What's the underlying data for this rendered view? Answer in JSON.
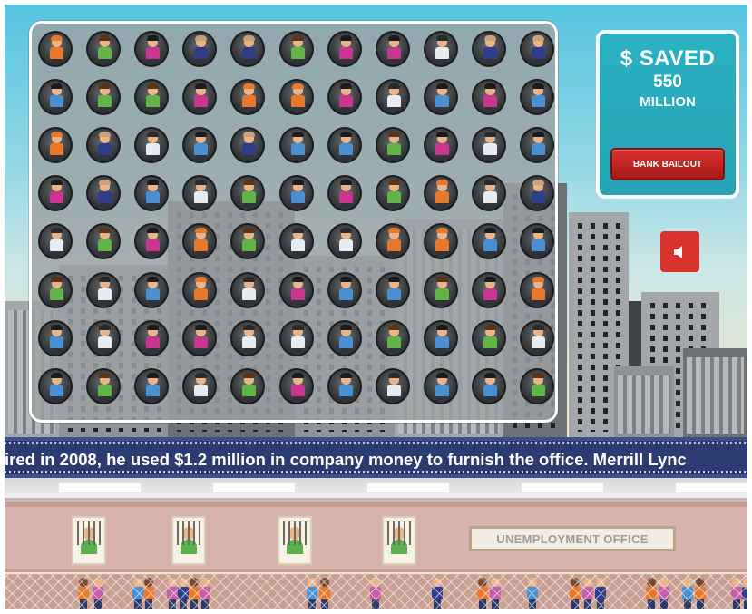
{
  "score": {
    "label": "$ SAVED",
    "amount": "550",
    "unit": "MILLION"
  },
  "buttons": {
    "bailout_label": "BANK BAILOUT",
    "mute_icon": "speaker-icon"
  },
  "ticker": {
    "text": "ired in 2008, he used $1.2 million in company money to furnish the office. Merrill Lync"
  },
  "office": {
    "sign": "UNEMPLOYMENT OFFICE"
  },
  "colors": {
    "sky": "#56c4df",
    "panel": "#2bb1c2",
    "button_red": "#d8322d",
    "ticker_bg": "#2d3b73",
    "office_wall": "#d8b2ad"
  },
  "board": {
    "rows": 8,
    "cols": 11,
    "grid": [
      [
        "orange",
        "green",
        "pink",
        "navy",
        "navy",
        "green",
        "pink",
        "pink",
        "white",
        "navy",
        "navy"
      ],
      [
        "blue",
        "green",
        "green",
        "pink",
        "orange",
        "orange",
        "pink",
        "white",
        "blue",
        "pink",
        "blue"
      ],
      [
        "orange",
        "navy",
        "white",
        "blue",
        "navy",
        "blue",
        "blue",
        "green",
        "pink",
        "white",
        "blue"
      ],
      [
        "pink",
        "navy",
        "blue",
        "white",
        "green",
        "blue",
        "pink",
        "green",
        "orange",
        "white",
        "navy"
      ],
      [
        "white",
        "green",
        "pink",
        "orange",
        "green",
        "white",
        "white",
        "orange",
        "orange",
        "blue",
        "blue"
      ],
      [
        "green",
        "white",
        "blue",
        "orange",
        "white",
        "pink",
        "blue",
        "blue",
        "green",
        "pink",
        "orange"
      ],
      [
        "blue",
        "white",
        "pink",
        "pink",
        "white",
        "white",
        "blue",
        "green",
        "blue",
        "green",
        "white"
      ],
      [
        "blue",
        "green",
        "blue",
        "white",
        "green",
        "pink",
        "blue",
        "white",
        "blue",
        "blue",
        "green"
      ]
    ]
  },
  "crowd_count": 24
}
